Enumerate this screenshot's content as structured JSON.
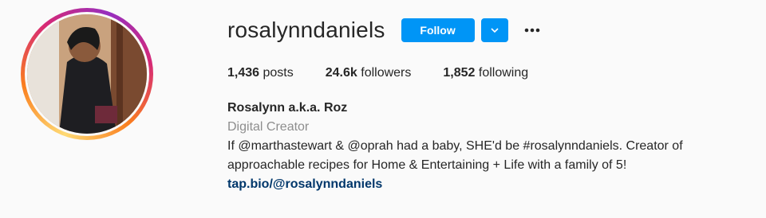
{
  "profile": {
    "username": "rosalynndaniels",
    "follow_label": "Follow",
    "stats": [
      {
        "value": "1,436",
        "label": "posts"
      },
      {
        "value": "24.6k",
        "label": "followers"
      },
      {
        "value": "1,852",
        "label": "following"
      }
    ],
    "full_name": "Rosalynn a.k.a. Roz",
    "category": "Digital Creator",
    "bio_line1": "If @marthastewart & @oprah had a baby, SHE'd be #rosalynndaniels. Creator of",
    "bio_line2": "approachable recipes for Home & Entertaining + Life with a family of 5!",
    "link": "tap.bio/@rosalynndaniels"
  },
  "colors": {
    "accent": "#0095f6",
    "link": "#00376b",
    "muted": "#8e8e8e",
    "background": "#fafafa"
  },
  "icons": {
    "dropdown": "chevron-down-icon",
    "more": "more-options-icon"
  }
}
